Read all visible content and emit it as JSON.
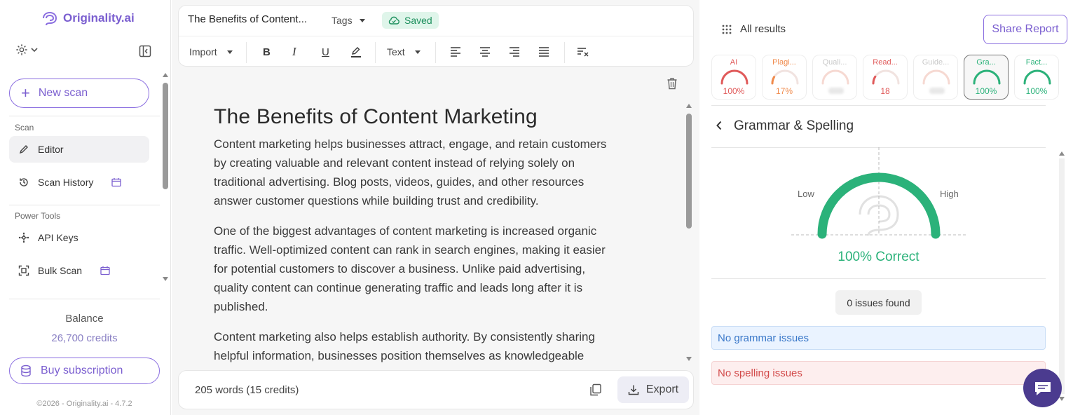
{
  "brand": {
    "name": "Originality.ai"
  },
  "sidebar": {
    "new_scan_label": "New scan",
    "sections": [
      {
        "label": "Scan",
        "items": [
          {
            "label": "Editor"
          },
          {
            "label": "Scan History"
          }
        ]
      },
      {
        "label": "Power Tools",
        "items": [
          {
            "label": "API Keys"
          },
          {
            "label": "Bulk Scan"
          }
        ]
      }
    ],
    "balance_label": "Balance",
    "credits": "26,700 credits",
    "buy_label": "Buy subscription",
    "copyright": "©2026 - Originality.ai - 4.7.2"
  },
  "editor": {
    "doc_title": "The Benefits of Content...",
    "tags_label": "Tags",
    "saved_label": "Saved",
    "toolbar": {
      "import_label": "Import",
      "bold": "B",
      "italic": "I",
      "underline": "U",
      "text_label": "Text"
    },
    "heading": "The Benefits of Content Marketing",
    "paragraphs": [
      "Content marketing helps businesses attract, engage, and retain customers by creating valuable and relevant content instead of relying solely on traditional advertising. Blog posts, videos, guides, and other resources answer customer questions while building trust and credibility.",
      "One of the biggest advantages of content marketing is increased organic traffic. Well-optimized content can rank in search engines, making it easier for potential customers to discover a business. Unlike paid advertising, quality content can continue generating traffic and leads long after it is published.",
      "Content marketing also helps establish authority. By consistently sharing helpful information, businesses position themselves as knowledgeable"
    ],
    "word_count": "205 words (15 credits)",
    "export_label": "Export"
  },
  "results": {
    "all_results_label": "All results",
    "share_label": "Share Report",
    "cards": [
      {
        "label": "AI",
        "value": "100%",
        "color": "#e05a5a",
        "fill": 1.0,
        "blurred": false
      },
      {
        "label": "Plagi...",
        "value": "17%",
        "color": "#f08a4b",
        "fill": 0.17,
        "blurred": false
      },
      {
        "label": "Quali...",
        "value": "",
        "color": "#f3b6a8",
        "fill": 0.0,
        "blurred": true
      },
      {
        "label": "Read...",
        "value": "18",
        "color": "#e05a5a",
        "fill": 0.18,
        "blurred": false
      },
      {
        "label": "Guide...",
        "value": "",
        "color": "#f3b6a8",
        "fill": 0.0,
        "blurred": true
      },
      {
        "label": "Gra...",
        "value": "100%",
        "color": "#2bb27a",
        "fill": 1.0,
        "blurred": false
      },
      {
        "label": "Fact...",
        "value": "100%",
        "color": "#2bb27a",
        "fill": 1.0,
        "blurred": false
      }
    ],
    "section_title": "Grammar & Spelling",
    "gauge": {
      "low_label": "Low",
      "high_label": "High",
      "level": 1.0,
      "color": "#2bb27a"
    },
    "correct_text": "100% Correct",
    "issues_text": "0 issues found",
    "grammar_banner": "No grammar issues",
    "spelling_banner": "No spelling issues"
  }
}
